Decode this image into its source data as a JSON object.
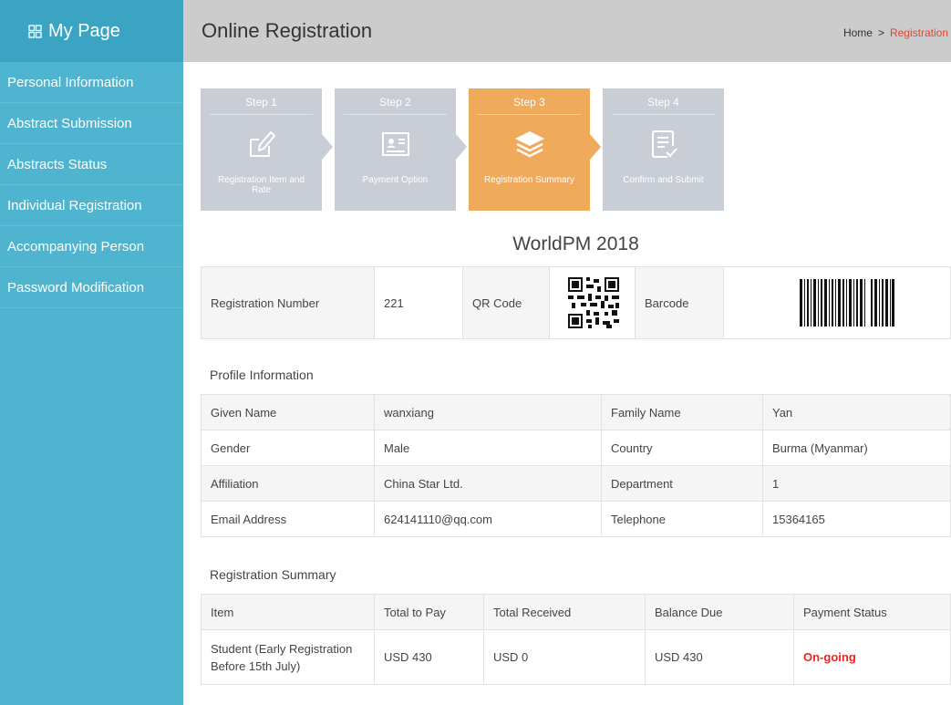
{
  "sidebar": {
    "title": "My Page",
    "items": [
      {
        "label": "Personal Information"
      },
      {
        "label": "Abstract Submission"
      },
      {
        "label": "Abstracts Status"
      },
      {
        "label": "Individual Registration"
      },
      {
        "label": "Accompanying Person"
      },
      {
        "label": "Password Modification"
      }
    ]
  },
  "header": {
    "title": "Online Registration",
    "breadcrumb": {
      "home": "Home",
      "separator": ">",
      "current": "Registration"
    }
  },
  "steps": [
    {
      "number": "Step 1",
      "label": "Registration Item and Rate",
      "icon": "edit-icon",
      "active": false
    },
    {
      "number": "Step 2",
      "label": "Payment Option",
      "icon": "id-card-icon",
      "active": false
    },
    {
      "number": "Step 3",
      "label": "Registration Summary",
      "icon": "layers-icon",
      "active": true
    },
    {
      "number": "Step 4",
      "label": "Confirm and Submit",
      "icon": "document-check-icon",
      "active": false
    }
  ],
  "event": {
    "title": "WorldPM 2018"
  },
  "registration": {
    "number_label": "Registration Number",
    "number_value": "221",
    "qr_label": "QR Code",
    "barcode_label": "Barcode"
  },
  "profile": {
    "title": "Profile Information",
    "rows": [
      [
        {
          "label": "Given Name",
          "value": "wanxiang"
        },
        {
          "label": "Family Name",
          "value": "Yan"
        }
      ],
      [
        {
          "label": "Gender",
          "value": "Male"
        },
        {
          "label": "Country",
          "value": "Burma (Myanmar)"
        }
      ],
      [
        {
          "label": "Affiliation",
          "value": "China Star Ltd."
        },
        {
          "label": "Department",
          "value": "1"
        }
      ],
      [
        {
          "label": "Email Address",
          "value": "624141110@qq.com"
        },
        {
          "label": "Telephone",
          "value": "15364165"
        }
      ]
    ]
  },
  "summary": {
    "title": "Registration Summary",
    "headers": [
      "Item",
      "Total to Pay",
      "Total Received",
      "Balance Due",
      "Payment Status"
    ],
    "row": {
      "item": "Student (Early Registration Before 15th July)",
      "total_to_pay": "USD 430",
      "total_received": "USD 0",
      "balance_due": "USD 430",
      "status": "On-going"
    }
  },
  "colors": {
    "sidebar": "#4fb4cf",
    "sidebar_header": "#3aa4c2",
    "step_active": "#f0aa5c",
    "step_inactive": "#c8cdd6",
    "status_red": "#e8261f"
  }
}
